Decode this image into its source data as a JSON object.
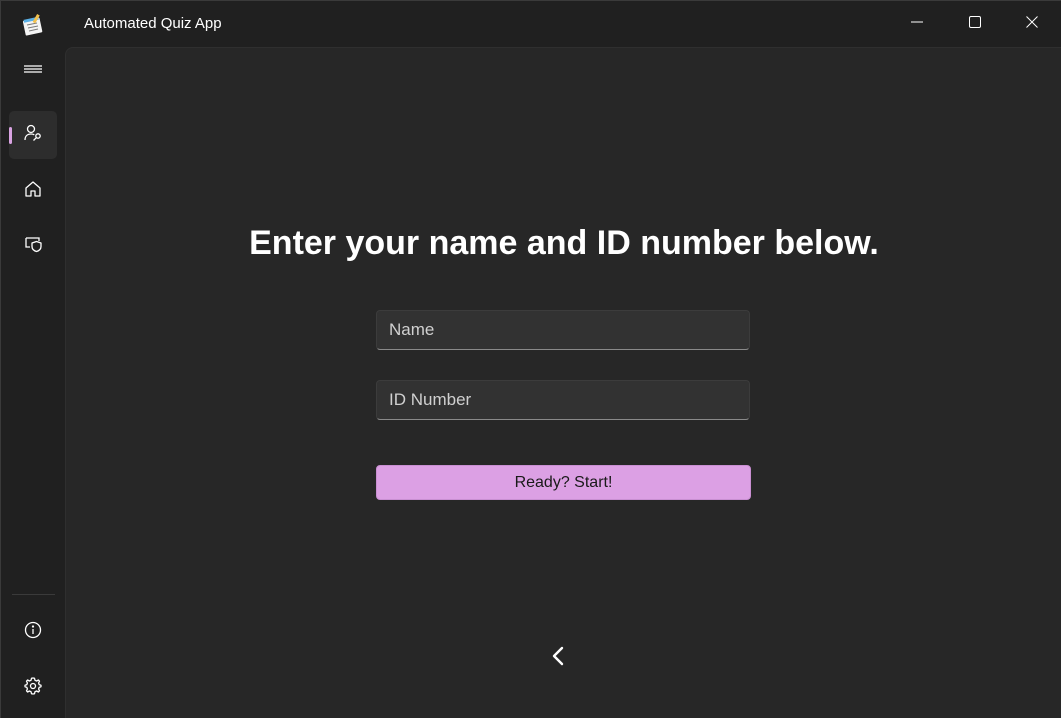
{
  "window": {
    "title": "Automated Quiz App",
    "app_icon": "quiz-notepad-icon",
    "caption_buttons": [
      "minimize-icon",
      "maximize-icon",
      "close-icon"
    ]
  },
  "nav": {
    "items": [
      {
        "id": "menu",
        "icon": "hamburger-icon",
        "active": false
      },
      {
        "id": "account",
        "icon": "person-key-icon",
        "active": true
      },
      {
        "id": "home",
        "icon": "home-icon",
        "active": false
      },
      {
        "id": "shield",
        "icon": "shield-monitor-icon",
        "active": false
      },
      {
        "id": "info",
        "icon": "info-icon",
        "active": false
      },
      {
        "id": "settings",
        "icon": "gear-icon",
        "active": false
      }
    ]
  },
  "main": {
    "heading": "Enter your name and ID number below.",
    "name_field": {
      "placeholder": "Name",
      "value": ""
    },
    "id_field": {
      "placeholder": "ID Number",
      "value": ""
    },
    "start_button_label": "Ready? Start!",
    "back_icon": "chevron-left-icon"
  },
  "colors": {
    "accent": "#dca0e4",
    "background": "#202020",
    "content_background": "#272727"
  }
}
